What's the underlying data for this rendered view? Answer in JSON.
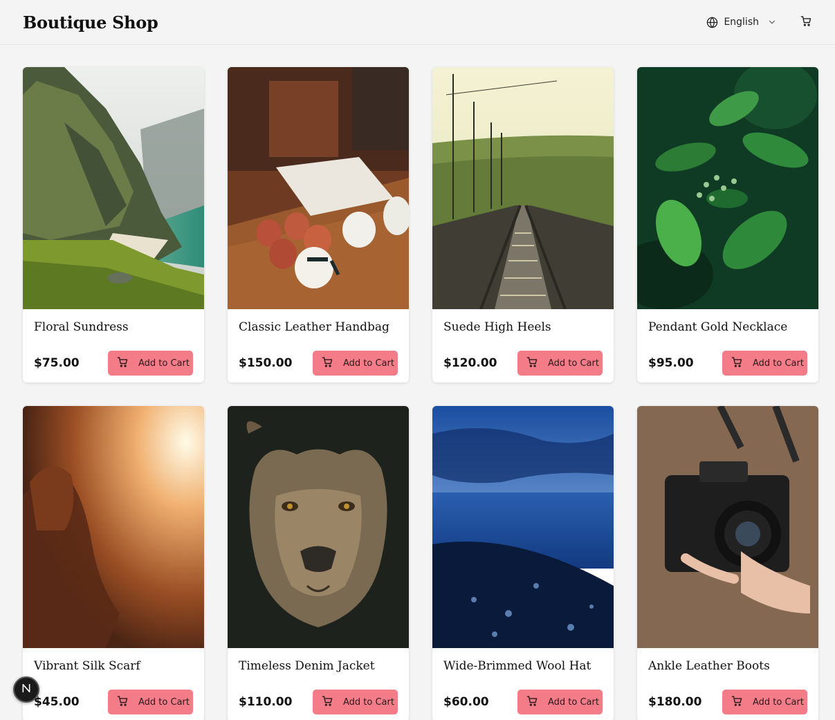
{
  "header": {
    "brand": "Boutique Shop",
    "language": "English",
    "icons": [
      "globe-icon",
      "chevron-down-icon",
      "cart-icon"
    ]
  },
  "products": [
    {
      "title": "Floral Sundress",
      "price": "$75.00",
      "button": "Add to Cart",
      "image": "mountain-coast-photo"
    },
    {
      "title": "Classic Leather Handbag",
      "price": "$150.00",
      "button": "Add to Cart",
      "image": "enamel-mugs-photo"
    },
    {
      "title": "Suede High Heels",
      "price": "$120.00",
      "button": "Add to Cart",
      "image": "railway-tracks-photo"
    },
    {
      "title": "Pendant Gold Necklace",
      "price": "$95.00",
      "button": "Add to Cart",
      "image": "green-leaves-photo"
    },
    {
      "title": "Vibrant Silk Scarf",
      "price": "$45.00",
      "button": "Add to Cart",
      "image": "sunset-woman-photo"
    },
    {
      "title": "Timeless Denim Jacket",
      "price": "$110.00",
      "button": "Add to Cart",
      "image": "lioness-photo"
    },
    {
      "title": "Wide-Brimmed Wool Hat",
      "price": "$60.00",
      "button": "Add to Cart",
      "image": "blue-shore-photo"
    },
    {
      "title": "Ankle Leather Boots",
      "price": "$180.00",
      "button": "Add to Cart",
      "image": "camera-photo"
    }
  ],
  "colors": {
    "accent": "#f47c89",
    "background": "#f4f4f5",
    "card": "#ffffff"
  },
  "floating_badge": {
    "icon": "next-logo-icon"
  }
}
